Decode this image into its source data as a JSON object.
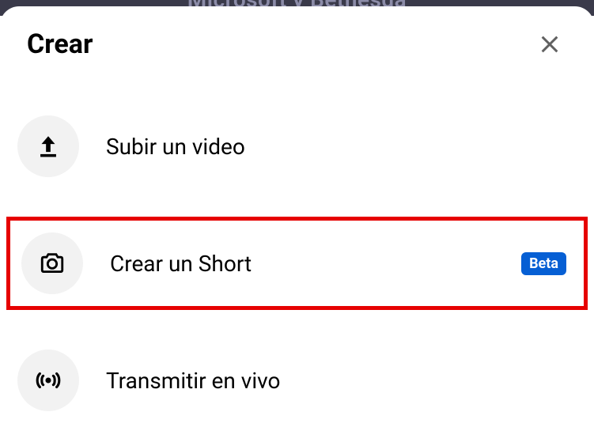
{
  "backdrop_text": "Microsoft y Bethesda",
  "sheet": {
    "title": "Crear",
    "options": [
      {
        "label": "Subir un video"
      },
      {
        "label": "Crear un Short",
        "badge": "Beta"
      },
      {
        "label": "Transmitir en vivo"
      }
    ]
  }
}
